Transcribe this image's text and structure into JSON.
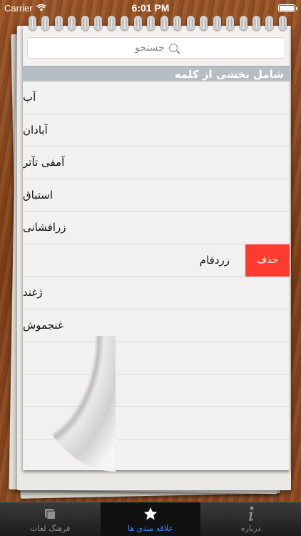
{
  "status_bar": {
    "carrier": "Carrier",
    "time": "6:01 PM"
  },
  "search": {
    "placeholder": "جستجو"
  },
  "section_header": "شامل بخشی از کلمه",
  "rows": [
    {
      "label": "آب"
    },
    {
      "label": "آبادان"
    },
    {
      "label": "آمفی تآتر"
    },
    {
      "label": "استباق"
    },
    {
      "label": "زرافشانی"
    },
    {
      "label": "زردفام",
      "delete": "حذف"
    },
    {
      "label": "ژغند"
    },
    {
      "label": "غنجموش"
    }
  ],
  "tabs": [
    {
      "label": "فرهنگ لغات",
      "icon": "book-icon"
    },
    {
      "label": "علاقه مندی ها",
      "icon": "star-icon",
      "active": true
    },
    {
      "label": "درباره",
      "icon": "info-icon"
    }
  ],
  "colors": {
    "delete": "#ff3b30",
    "header": "#b7bdc5",
    "active_tab": "#3a8bff"
  }
}
